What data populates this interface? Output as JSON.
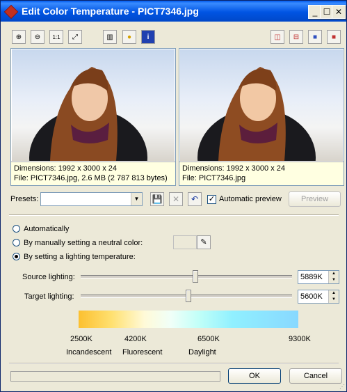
{
  "window": {
    "title": "Edit Color Temperature - PICT7346.jpg",
    "controls": {
      "minimize": "_",
      "maximize": "☐",
      "close": "✕"
    }
  },
  "toolbar_left": [
    {
      "name": "zoom-in-icon",
      "glyph": "⊕"
    },
    {
      "name": "zoom-out-icon",
      "glyph": "⊖"
    },
    {
      "name": "actual-size-icon",
      "glyph": "1:1"
    },
    {
      "name": "fit-to-window-icon",
      "glyph": "⤢"
    },
    {
      "name": "histogram-icon",
      "glyph": "▥"
    },
    {
      "name": "highlight-icon",
      "glyph": "●"
    },
    {
      "name": "info-icon",
      "glyph": "i"
    }
  ],
  "toolbar_right": [
    {
      "name": "split-vertical-icon",
      "glyph": "◫"
    },
    {
      "name": "split-horizontal-icon",
      "glyph": "⊟"
    },
    {
      "name": "original-only-icon",
      "glyph": "■"
    },
    {
      "name": "preview-only-icon",
      "glyph": "■"
    }
  ],
  "left_panel": {
    "dimensions": "Dimensions: 1992 x 3000 x 24",
    "file": "File: PICT7346.jpg, 2.6 MB (2 787 813 bytes)"
  },
  "right_panel": {
    "dimensions": "Dimensions: 1992 x 3000 x 24",
    "file": "File: PICT7346.jpg"
  },
  "presets": {
    "label": "Presets:",
    "value": "",
    "save_icon": "💾",
    "delete_icon": "✕",
    "reset_icon": "↶",
    "automatic_preview_label": "Automatic preview",
    "automatic_preview_checked": true,
    "preview_button": "Preview"
  },
  "options": {
    "automatically": "Automatically",
    "neutral": "By manually setting a neutral color:",
    "lighting": "By setting a lighting temperature:",
    "selected": "lighting",
    "eyedropper_icon": "✎"
  },
  "sliders": {
    "source_label": "Source lighting:",
    "source_value": "5889K",
    "source_level": 5889,
    "target_label": "Target lighting:",
    "target_value": "5600K",
    "target_level": 5600
  },
  "scale": {
    "ticks": [
      {
        "value": "2500K",
        "name": "Incandescent"
      },
      {
        "value": "4200K",
        "name": "Fluorescent"
      },
      {
        "value": "6500K",
        "name": "Daylight"
      },
      {
        "value": "9300K",
        "name": ""
      }
    ]
  },
  "buttons": {
    "ok": "OK",
    "cancel": "Cancel"
  },
  "progress": 0
}
